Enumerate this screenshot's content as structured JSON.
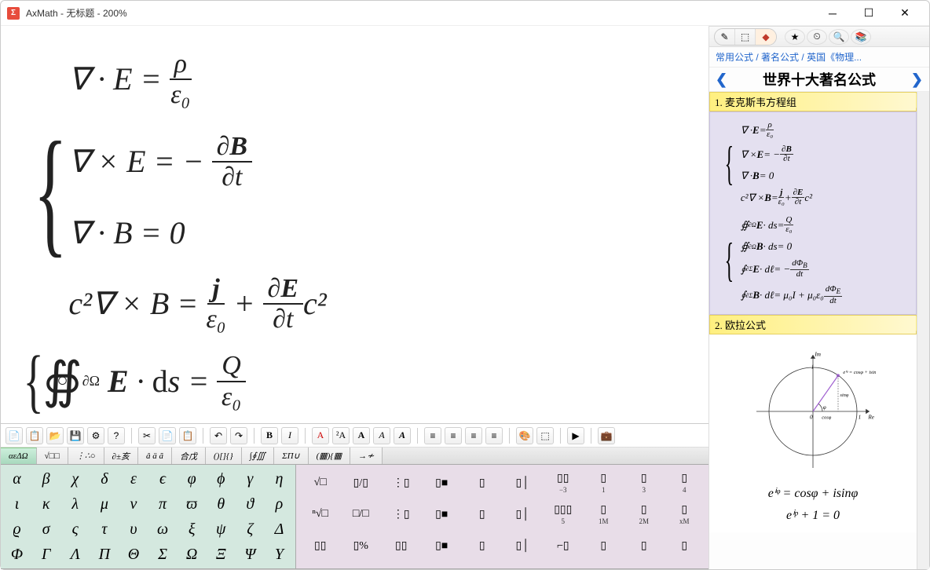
{
  "window": {
    "app_icon_glyph": "Σ",
    "title": "AxMath - 无标题 - 200%"
  },
  "editor": {
    "eq1": "∇ · E =",
    "eq1_num": "ρ",
    "eq1_den": "ε₀",
    "eq2": "∇ × E = −",
    "eq2_num": "∂B",
    "eq2_den": "∂t",
    "eq3": "∇ · B = 0",
    "eq4_pre": "c²∇ × B =",
    "eq4_n1": "j",
    "eq4_d1": "ε₀",
    "eq4_plus": "+",
    "eq4_n2": "∂E",
    "eq4_d2": "∂t",
    "eq4_post": "c²",
    "eq5_op": "∯",
    "eq5_sub": "∂Ω",
    "eq5_mid": "E · ds =",
    "eq5_num": "Q",
    "eq5_den": "ε₀"
  },
  "toolbar": {
    "icons": [
      "📄",
      "📋",
      "📂",
      "💾",
      "⚙",
      "?",
      "✂",
      "📄",
      "📋",
      "↶",
      "↷"
    ]
  },
  "format_icons": [
    "B",
    "I",
    "A",
    "²A",
    "A",
    "A",
    "A",
    "≡",
    "≡",
    "≡",
    "≡",
    "🎨",
    "⬚",
    "▶",
    "💼"
  ],
  "tabs": [
    "αεΔΩ",
    "√□□",
    "⋮∴○",
    "∂±亥",
    "â ä ã",
    "合戊",
    "()[]{}",
    "∫∮∭",
    "ΣΠ∪",
    "(▦){▦",
    "→≁"
  ],
  "greek": [
    "α",
    "β",
    "χ",
    "δ",
    "ε",
    "ϵ",
    "φ",
    "ϕ",
    "γ",
    "η",
    "ι",
    "κ",
    "λ",
    "μ",
    "ν",
    "π",
    "ϖ",
    "θ",
    "ϑ",
    "ρ",
    "ϱ",
    "σ",
    "ς",
    "τ",
    "υ",
    "ω",
    "ξ",
    "ψ",
    "ζ",
    "Δ",
    "Φ",
    "Γ",
    "Λ",
    "Π",
    "Θ",
    "Σ",
    "Ω",
    "Ξ",
    "Ψ",
    "Υ"
  ],
  "layout_items": [
    {
      "l": "√□"
    },
    {
      "l": "▯/▯"
    },
    {
      "l": "⋮▯"
    },
    {
      "l": "▯■"
    },
    {
      "l": "▯"
    },
    {
      "l": "▯│"
    },
    {
      "l": "▯▯",
      "s": "−3"
    },
    {
      "l": "▯",
      "s": "1"
    },
    {
      "l": "▯",
      "s": "3"
    },
    {
      "l": "▯",
      "s": "4"
    },
    {
      "l": "ⁿ√□"
    },
    {
      "l": "□/□"
    },
    {
      "l": "⋮▯"
    },
    {
      "l": "▯■"
    },
    {
      "l": "▯"
    },
    {
      "l": "▯│"
    },
    {
      "l": "▯▯▯",
      "s": "5"
    },
    {
      "l": "▯",
      "s": "1M"
    },
    {
      "l": "▯",
      "s": "2M"
    },
    {
      "l": "▯",
      "s": "xM"
    },
    {
      "l": "▯▯"
    },
    {
      "l": "▯%"
    },
    {
      "l": "▯▯"
    },
    {
      "l": "▯■"
    },
    {
      "l": "▯"
    },
    {
      "l": "▯│"
    },
    {
      "l": "⌐▯"
    },
    {
      "l": "▯"
    },
    {
      "l": "▯"
    },
    {
      "l": "▯"
    }
  ],
  "right_panel": {
    "toolbar_icons": [
      "✎",
      "⬚",
      "◆",
      "★",
      "⏲",
      "🔍",
      "📚"
    ],
    "breadcrumb_1": "常用公式",
    "breadcrumb_2": "著名公式",
    "breadcrumb_3": "英国《物理...",
    "nav_title": "世界十大著名公式",
    "section1": "1. 麦克斯韦方程组",
    "section2": "2. 欧拉公式",
    "s1_lines": [
      "∇ · E = ρ / ε₀",
      "∇ × E = − ∂B / ∂t",
      "∇ · B = 0",
      "c²∇ × B = j/ε₀ + ∂E/∂t c²"
    ],
    "s1_lines2": [
      "∯∂Ω E · ds = Q / ε₀",
      "∯∂Ω B · ds = 0",
      "∮∂Σ E · dℓ = − dΦB/dt",
      "∮∂Σ B · dℓ = μ₀I + μ₀ε₀ dΦE/dt"
    ],
    "euler_diagram": {
      "im_label": "Im",
      "re_label": "Re",
      "e_label": "eⁱᵠ = cosφ + isinφ",
      "sin_label": "sinφ",
      "cos_label": "cosφ",
      "phi": "φ",
      "zero": "0",
      "one": "1"
    },
    "euler_eq1": "eⁱᵠ = cosφ + isinφ",
    "euler_eq2": "eⁱᵖ + 1 = 0"
  }
}
